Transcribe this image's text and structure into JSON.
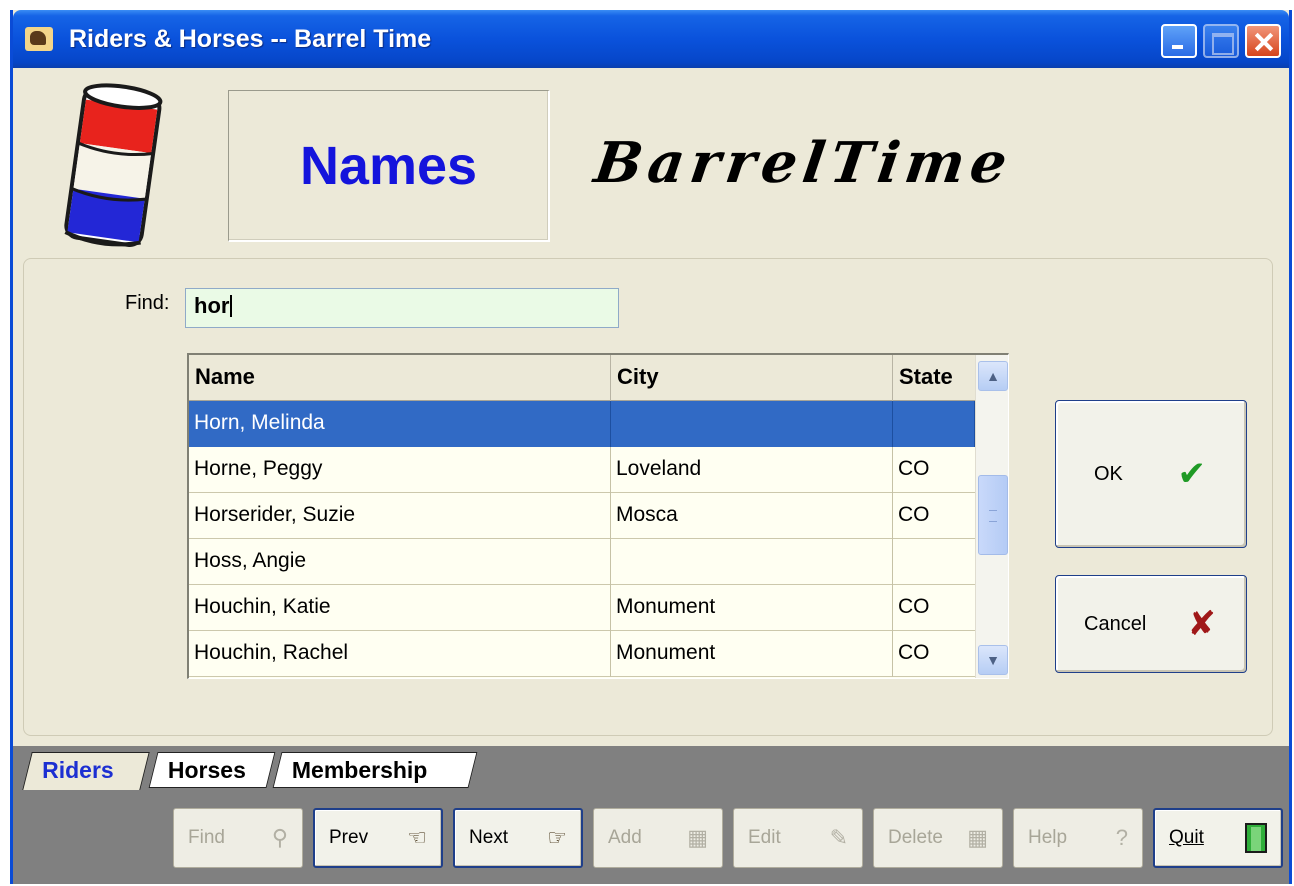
{
  "window": {
    "title": "Riders & Horses -- Barrel Time",
    "controls": [
      "minimize",
      "maximize",
      "close"
    ]
  },
  "header": {
    "section_title": "Names",
    "brand": "BarrelTime",
    "logo_icon": "barrel-icon"
  },
  "find": {
    "label": "Find:",
    "value": "hor"
  },
  "grid": {
    "columns": [
      "Name",
      "City",
      "State"
    ],
    "rows": [
      {
        "name": "Horn, Melinda",
        "city": "",
        "state": "",
        "selected": true
      },
      {
        "name": "Horne, Peggy",
        "city": "Loveland",
        "state": "CO"
      },
      {
        "name": "Horserider, Suzie",
        "city": "Mosca",
        "state": "CO"
      },
      {
        "name": "Hoss, Angie",
        "city": "",
        "state": ""
      },
      {
        "name": "Houchin, Katie",
        "city": "Monument",
        "state": "CO"
      },
      {
        "name": "Houchin, Rachel",
        "city": "Monument",
        "state": "CO"
      }
    ]
  },
  "buttons": {
    "ok": "OK",
    "cancel": "Cancel"
  },
  "tabs": [
    {
      "label": "Riders",
      "active": true
    },
    {
      "label": "Horses",
      "active": false
    },
    {
      "label": "Membership",
      "active": false
    }
  ],
  "toolbar": {
    "find": "Find",
    "prev": "Prev",
    "next": "Next",
    "add": "Add",
    "edit": "Edit",
    "delete": "Delete",
    "help": "Help",
    "quit": "Quit"
  },
  "colors": {
    "title_bar": "#0a52dc",
    "names_text": "#1414dc",
    "selected_row": "#316ac5",
    "grid_bg": "#fffff2",
    "active_tab_text": "#1c2fd2"
  }
}
